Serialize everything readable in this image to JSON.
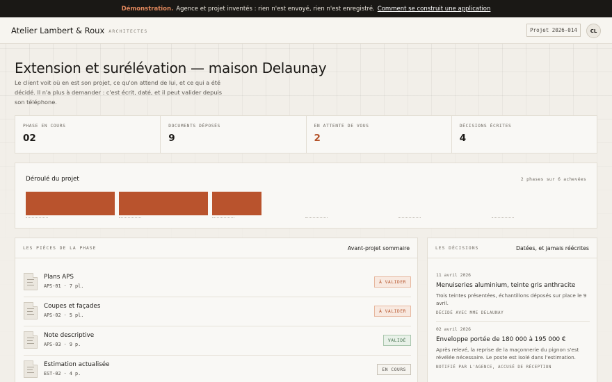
{
  "banner": {
    "highlight": "Démonstration.",
    "text": "Agence et projet inventés : rien n'est envoyé, rien n'est enregistré.",
    "link": "Comment se construit une application"
  },
  "header": {
    "brand": "Atelier Lambert & Roux",
    "brand_sub": "ARCHITECTES",
    "project_tag": "Projet 2026-014",
    "avatar_initials": "CL"
  },
  "page": {
    "title": "Extension et surélévation — maison Delaunay",
    "lead": "Le client voit où en est son projet, ce qu'on attend de lui, et ce qui a été décidé. Il n'a plus à demander : c'est écrit, daté, et il peut valider depuis son téléphone."
  },
  "stats": [
    {
      "label": "PHASE EN COURS",
      "value": "02",
      "accent": false
    },
    {
      "label": "DOCUMENTS DÉPOSÉS",
      "value": "9",
      "accent": false
    },
    {
      "label": "EN ATTENTE DE VOUS",
      "value": "2",
      "accent": true
    },
    {
      "label": "DÉCISIONS ÉCRITES",
      "value": "4",
      "accent": false
    }
  ],
  "timeline": {
    "title": "Déroulé du projet",
    "summary": "2 phases sur 6 achevées",
    "phases": [
      {
        "status": "done"
      },
      {
        "status": "done"
      },
      {
        "status": "current"
      },
      {
        "status": "upcoming"
      },
      {
        "status": "upcoming"
      },
      {
        "status": "upcoming"
      }
    ],
    "accent_color": "#b9532d"
  },
  "pieces": {
    "caption": "LES PIÈCES DE LA PHASE",
    "phase_name": "Avant-projet sommaire",
    "items": [
      {
        "name": "Plans APS",
        "meta": "APS-01 · 7 pl.",
        "status": "À VALIDER",
        "kind": "warn"
      },
      {
        "name": "Coupes et façades",
        "meta": "APS-02 · 5 pl.",
        "status": "À VALIDER",
        "kind": "warn"
      },
      {
        "name": "Note descriptive",
        "meta": "APS-03 · 9 p.",
        "status": "VALIDÉ",
        "kind": "ok"
      },
      {
        "name": "Estimation actualisée",
        "meta": "EST-02 · 4 p.",
        "status": "EN COURS",
        "kind": "prog"
      }
    ]
  },
  "decisions": {
    "caption": "LES DÉCISIONS",
    "subtitle": "Datées, et jamais réécrites",
    "items": [
      {
        "date": "11 avril 2026",
        "title": "Menuiseries aluminium, teinte gris anthracite",
        "text": "Trois teintes présentées, échantillons déposés sur place le 9 avril.",
        "foot": "DÉCIDÉ AVEC MME DELAUNAY"
      },
      {
        "date": "02 avril 2026",
        "title": "Enveloppe portée de 180 000 à 195 000 €",
        "text": "Après relevé, la reprise de la maçonnerie du pignon s'est révélée nécessaire. Le poste est isolé dans l'estimation.",
        "foot": "NOTIFIÉ PAR L'AGENCE, ACCUSÉ DE RÉCEPTION"
      }
    ]
  }
}
